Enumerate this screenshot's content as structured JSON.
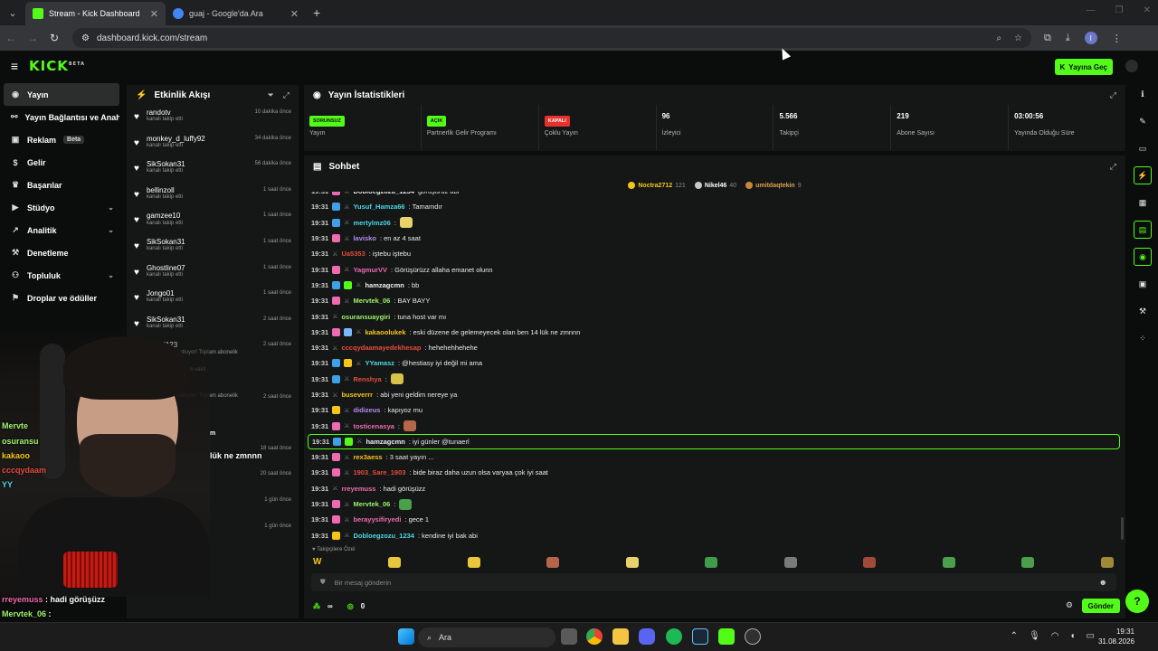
{
  "browser": {
    "tabs": [
      {
        "title": "Stream - Kick Dashboard",
        "active": true,
        "favicon_color": "#53fc18"
      },
      {
        "title": "guaj - Google'da Ara",
        "active": false,
        "favicon_color": "#4285f4"
      }
    ],
    "url": "dashboard.kick.com/stream",
    "profile_initial": "I"
  },
  "kick": {
    "logo": "KICK",
    "logo_sup": "BETA",
    "go_live_label": "Yayına Geç",
    "accent": "#53fc18"
  },
  "sidebar": {
    "items": [
      {
        "label": "Yayın",
        "icon": "broadcast-icon",
        "active": true,
        "chevron": false
      },
      {
        "label": "Yayın Bağlantısı ve Anahtar",
        "icon": "link-icon",
        "active": false,
        "chevron": false
      },
      {
        "label": "Reklam",
        "icon": "ad-icon",
        "active": false,
        "chevron": false,
        "badge": "Beta"
      },
      {
        "label": "Gelir",
        "icon": "dollar-icon",
        "active": false,
        "chevron": false
      },
      {
        "label": "Başarılar",
        "icon": "trophy-icon",
        "active": false,
        "chevron": false
      },
      {
        "label": "Stüdyo",
        "icon": "studio-icon",
        "active": false,
        "chevron": true
      },
      {
        "label": "Analitik",
        "icon": "analytics-icon",
        "active": false,
        "chevron": true
      },
      {
        "label": "Denetleme",
        "icon": "hammer-icon",
        "active": false,
        "chevron": false
      },
      {
        "label": "Topluluk",
        "icon": "community-icon",
        "active": false,
        "chevron": true
      },
      {
        "label": "Droplar ve ödüller",
        "icon": "gift-icon",
        "active": false,
        "chevron": false
      }
    ]
  },
  "activity": {
    "title": "Etkinlik Akışı",
    "items": [
      {
        "name": "randotv",
        "sub": "kanalı takip etti",
        "time": "10 dakika önce"
      },
      {
        "name": "monkey_d_luffy92",
        "sub": "kanalı takip etti",
        "time": "34 dakika önce"
      },
      {
        "name": "SikSokan31",
        "sub": "kanalı takip etti",
        "time": "56 dakika önce"
      },
      {
        "name": "bellinzoll",
        "sub": "kanalı takip etti",
        "time": "1 saat önce"
      },
      {
        "name": "gamzee10",
        "sub": "kanalı takip etti",
        "time": "1 saat önce"
      },
      {
        "name": "SikSokan31",
        "sub": "kanalı takip etti",
        "time": "1 saat önce"
      },
      {
        "name": "Ghostline07",
        "sub": "kanalı takip etti",
        "time": "1 saat önce"
      },
      {
        "name": "Jongo01",
        "sub": "kanalı takip etti",
        "time": "1 saat önce"
      },
      {
        "name": "SikSokan31",
        "sub": "kanalı takip etti",
        "time": "2 saat önce"
      },
      {
        "name": "VCISI123",
        "sub": "...nilemesini kutluyor! Toplam abonelik",
        "time": "2 saat önce"
      },
      {
        "name": "",
        "sub": "...la ne cabuk gecio vakit",
        "time": ""
      },
      {
        "name": "",
        "sub": "...nilemesini kutluyor! Toplam abonelik",
        "time": "2 saat önce"
      },
      {
        "name": "",
        "sub": "",
        "time": ""
      },
      {
        "name": "",
        "sub": "",
        "time": "18 saat önce"
      },
      {
        "name": "",
        "sub": "",
        "time": "20 saat önce"
      },
      {
        "name": "",
        "sub": "",
        "time": "1 gün önce"
      },
      {
        "name": "",
        "sub": "",
        "time": "1 gün önce"
      },
      {
        "name": "",
        "sub": "kanalı takip etti",
        "time": ""
      }
    ]
  },
  "stats": {
    "title": "Yayın İstatistikleri",
    "items": [
      {
        "badge": "SORUNSUZ",
        "badge_color": "#53fc18",
        "value": "",
        "label": "Yayın"
      },
      {
        "badge": "AÇIK",
        "badge_color": "#53fc18",
        "value": "",
        "label": "Partnerlik Gelir Programı"
      },
      {
        "badge": "KAPALI",
        "badge_color": "#e5322d",
        "value": "",
        "label": "Çoklu Yayın"
      },
      {
        "badge": "",
        "badge_color": "",
        "value": "96",
        "label": "İzleyici"
      },
      {
        "badge": "",
        "badge_color": "",
        "value": "5.566",
        "label": "Takipçi"
      },
      {
        "badge": "",
        "badge_color": "",
        "value": "219",
        "label": "Abone Sayısı"
      },
      {
        "badge": "",
        "badge_color": "",
        "value": "03:00:56",
        "label": "Yayında Olduğu Süre"
      }
    ]
  },
  "chat": {
    "title": "Sohbet",
    "leaders": [
      {
        "name": "Noctra2712",
        "count": "121",
        "color": "#f5c518",
        "name_color": "#f5c518"
      },
      {
        "name": "Nikel46",
        "count": "40",
        "color": "#c8c8c8",
        "name_color": "#ffffff"
      },
      {
        "name": "umitdaqtekin",
        "count": "9",
        "color": "#c9863a",
        "name_color": "#e0a050"
      }
    ],
    "messages": [
      {
        "time": "19:31",
        "badges": [
          "#f06ab2"
        ],
        "user": "Dobloegzozu_1234",
        "user_color": "#f0f0f0",
        "text": "görüşürüz abi",
        "emote": ""
      },
      {
        "time": "19:31",
        "badges": [
          "#3ea0e6"
        ],
        "user": "Yusuf_Hamza66",
        "user_color": "#4fd6e8",
        "text": ": Tamamdır",
        "emote": ""
      },
      {
        "time": "19:31",
        "badges": [
          "#3ea0e6"
        ],
        "user": "mertylmz06",
        "user_color": "#4fd6e8",
        "text": ":",
        "emote": "#e8d36a"
      },
      {
        "time": "19:31",
        "badges": [
          "#f06ab2"
        ],
        "user": "lavisko",
        "user_color": "#b48cf0",
        "text": ": en az 4 saat",
        "emote": ""
      },
      {
        "time": "19:31",
        "badges": [],
        "user": "Ua5353",
        "user_color": "#e74c3c",
        "text": ": iştebu iştebu",
        "emote": ""
      },
      {
        "time": "19:31",
        "badges": [
          "#f06ab2"
        ],
        "user": "YagmurVV",
        "user_color": "#f06ab2",
        "text": ": Görüşürüzz allaha emanet olunn",
        "emote": ""
      },
      {
        "time": "19:31",
        "badges": [
          "#3ea0e6",
          "#53fc18"
        ],
        "user": "hamzagcmn",
        "user_color": "#f0f0f0",
        "text": ": bb",
        "emote": ""
      },
      {
        "time": "19:31",
        "badges": [
          "#f06ab2"
        ],
        "user": "Mervtek_06",
        "user_color": "#9ef36b",
        "text": ": BAY BAYY",
        "emote": ""
      },
      {
        "time": "19:31",
        "badges": [],
        "user": "osuransuaygiri",
        "user_color": "#9ef36b",
        "text": ": tuna host var mı",
        "emote": ""
      },
      {
        "time": "19:31",
        "badges": [
          "#f06ab2",
          "#7ab8ff"
        ],
        "user": "kakaoolukek",
        "user_color": "#f5c518",
        "text": ": eski düzene de gelemeyecek olan ben 14 lük ne zmnnn",
        "emote": ""
      },
      {
        "time": "19:31",
        "badges": [],
        "user": "cccqydaamayedekhesap",
        "user_color": "#e74c3c",
        "text": ": hehehehhehehe",
        "emote": ""
      },
      {
        "time": "19:31",
        "badges": [
          "#3ea0e6",
          "#f5c518"
        ],
        "user": "YYamasz",
        "user_color": "#4fd6e8",
        "text": ": @hestiasy iyi değil mi ama",
        "emote": ""
      },
      {
        "time": "19:31",
        "badges": [
          "#3ea0e6"
        ],
        "user": "Renshya",
        "user_color": "#e74c3c",
        "text": ":",
        "emote": "#d9c24a"
      },
      {
        "time": "19:31",
        "badges": [],
        "user": "buseverrr",
        "user_color": "#f5c518",
        "text": ": abi yeni geldim nereye ya",
        "emote": ""
      },
      {
        "time": "19:31",
        "badges": [
          "#f5c518"
        ],
        "user": "didizeus",
        "user_color": "#b48cf0",
        "text": ": kapıyoz mu",
        "emote": ""
      },
      {
        "time": "19:31",
        "badges": [
          "#f06ab2"
        ],
        "user": "tosticenasya",
        "user_color": "#f06ab2",
        "text": ":",
        "emote": "#b5664a"
      },
      {
        "time": "19:31",
        "badges": [
          "#3ea0e6",
          "#53fc18"
        ],
        "user": "hamzagcmn",
        "user_color": "#f0f0f0",
        "text": ": iyi günler @tunaerl",
        "emote": "",
        "highlight": true
      },
      {
        "time": "19:31",
        "badges": [
          "#f06ab2"
        ],
        "user": "rex3aess",
        "user_color": "#f5c518",
        "text": ": 3 saat yayın ...",
        "emote": ""
      },
      {
        "time": "19:31",
        "badges": [
          "#f06ab2"
        ],
        "user": "1903_Sare_1903",
        "user_color": "#e74c3c",
        "text": ": bide biraz daha uzun olsa varyaa çok iyi saat",
        "emote": ""
      },
      {
        "time": "19:31",
        "badges": [],
        "user": "rreyemuss",
        "user_color": "#f06ab2",
        "text": ": hadi görüşüzz",
        "emote": ""
      },
      {
        "time": "19:31",
        "badges": [
          "#f06ab2"
        ],
        "user": "Mervtek_06",
        "user_color": "#9ef36b",
        "text": ":",
        "emote": "#4aa04a"
      },
      {
        "time": "19:31",
        "badges": [
          "#f06ab2"
        ],
        "user": "berayysifiryedi",
        "user_color": "#f06ab2",
        "text": ": gece 1",
        "emote": ""
      },
      {
        "time": "19:31",
        "badges": [
          "#f5c518"
        ],
        "user": "Dobloegzozu_1234",
        "user_color": "#4fd6e8",
        "text": ": kendine iyi bak abi",
        "emote": ""
      }
    ],
    "followers_only": "Takipçilere Özel",
    "emote_colors": [
      "#e8c73a",
      "#e8c73a",
      "#b5664a",
      "#e8d36a",
      "#3f9c4a",
      "#7a7a7a",
      "#a24a3a",
      "#4aa04a",
      "#4aa04a",
      "#a08a3a"
    ],
    "input_placeholder": "Bir mesaj gönderin",
    "points_value": "∞",
    "coins_value": "0",
    "send_label": "Gönder"
  },
  "overlay": {
    "lines": [
      {
        "user": "Mervte",
        "color": "#9ef36b",
        "text": ""
      },
      {
        "user": "osuransu",
        "color": "#9ef36b",
        "text": ""
      },
      {
        "user": "kakaoo",
        "color": "#f5c518",
        "text": ""
      },
      {
        "user": "cccqydaam",
        "color": "#e74c3c",
        "text": ""
      },
      {
        "user": "YY",
        "color": "#4fd6e8",
        "text": ""
      },
      {
        "user": "rreyemuss",
        "color": "#f06ab2",
        "text": " : hadi görüşüzz"
      },
      {
        "user": "Mervtek_06",
        "color": "#9ef36b",
        "text": " :"
      },
      {
        "user": "berayysifiryedi",
        "color": "#f06ab2",
        "text": " : gece 1"
      },
      {
        "user": "Dobloegzozu_1234",
        "color": "#4fd6e8",
        "text": " : kendine iyi bak abi"
      }
    ],
    "partial_text": "lük ne zmnnn",
    "partial_text2": "m"
  },
  "taskbar": {
    "search_placeholder": "Ara",
    "time": "19:31",
    "date": "31.08.2026"
  }
}
